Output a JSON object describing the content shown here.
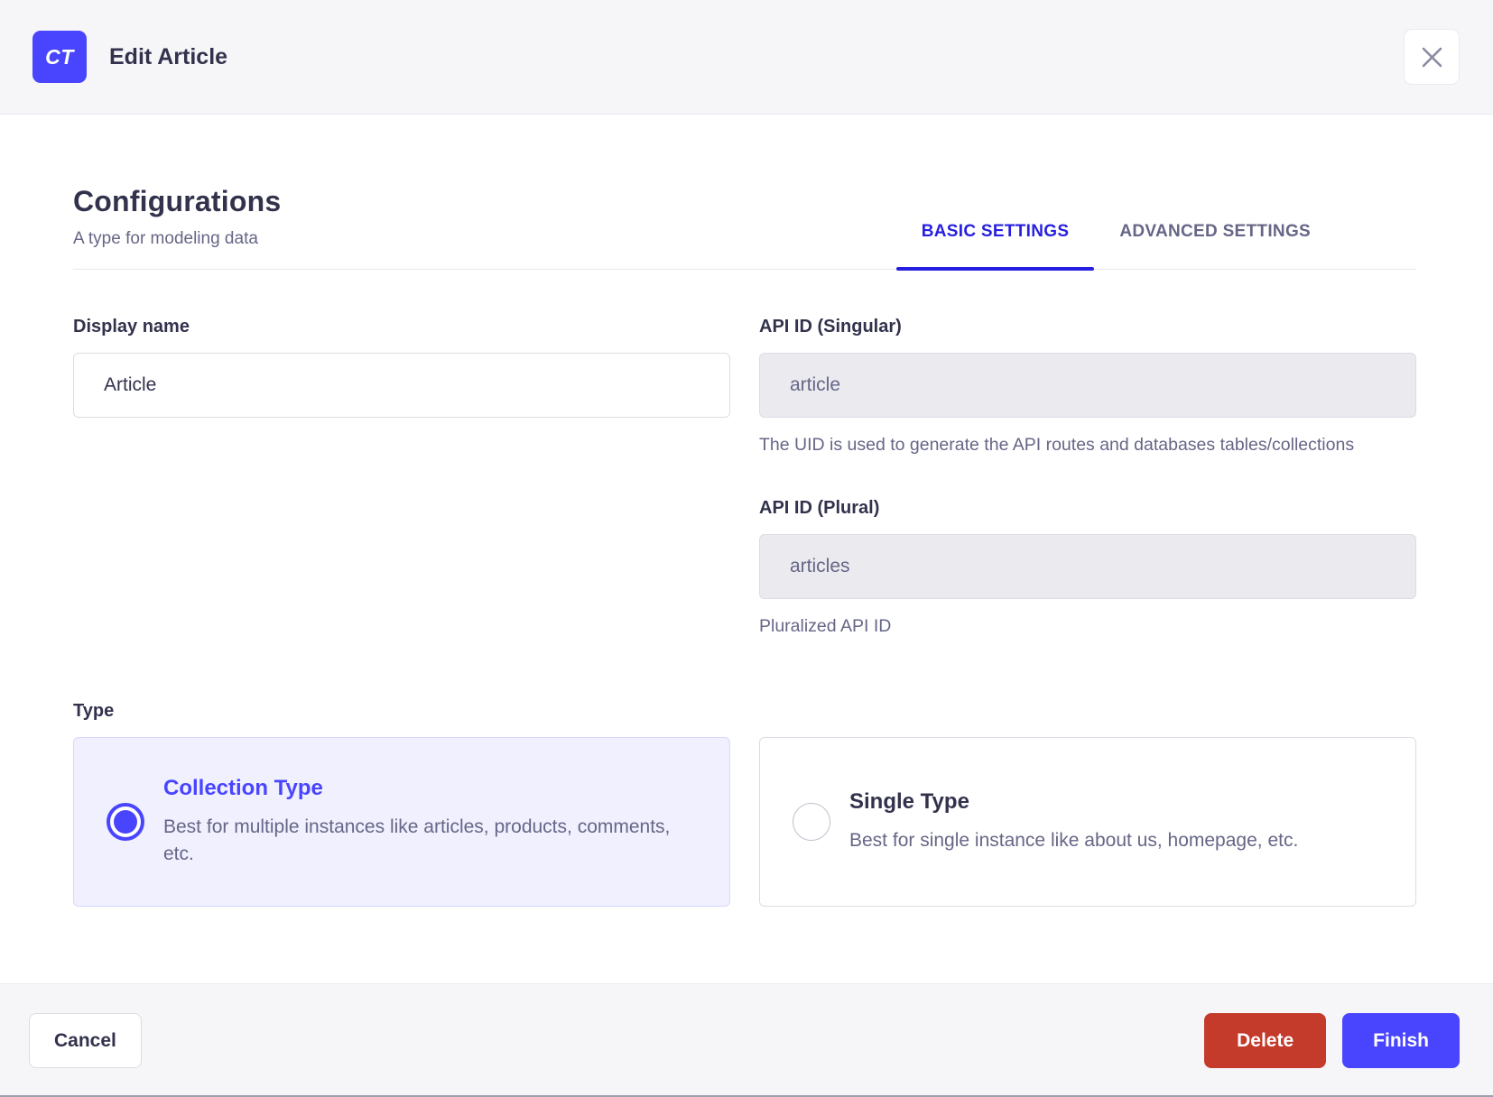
{
  "colors": {
    "accent": "#4945ff",
    "tab_active": "#271fe0",
    "danger": "#c43a2b",
    "header_bg": "#f6f6f9",
    "selected_card_bg": "#f0f0ff",
    "text_dark": "#32324d",
    "text_muted": "#666687"
  },
  "header": {
    "badge_label": "CT",
    "title": "Edit Article",
    "close_icon": "close-x"
  },
  "section": {
    "title": "Configurations",
    "subtitle": "A type for modeling data"
  },
  "tabs": [
    {
      "label": "BASIC SETTINGS",
      "active": true
    },
    {
      "label": "ADVANCED SETTINGS",
      "active": false
    }
  ],
  "form": {
    "display_name": {
      "label": "Display name",
      "value": "Article"
    },
    "api_id_singular": {
      "label": "API ID (Singular)",
      "value": "article",
      "hint": "The UID is used to generate the API routes and databases tables/collections"
    },
    "api_id_plural": {
      "label": "API ID (Plural)",
      "value": "articles",
      "hint": "Pluralized API ID"
    },
    "type": {
      "label": "Type",
      "options": [
        {
          "title": "Collection Type",
          "description": "Best for multiple instances like articles, products, comments, etc.",
          "selected": true
        },
        {
          "title": "Single Type",
          "description": "Best for single instance like about us, homepage, etc.",
          "selected": false
        }
      ]
    }
  },
  "footer": {
    "cancel_label": "Cancel",
    "delete_label": "Delete",
    "finish_label": "Finish"
  }
}
